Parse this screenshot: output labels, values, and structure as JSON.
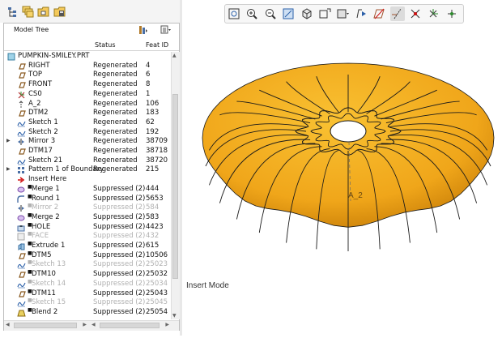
{
  "model_tree": {
    "title": "Model Tree",
    "columns": {
      "status": "Status",
      "feat_id": "Feat ID"
    },
    "root": "PUMPKIN-SMILEY.PRT",
    "rows": [
      {
        "name": "RIGHT",
        "status": "Regenerated",
        "id": "4",
        "icon": "datum-plane-icon",
        "state": "normal"
      },
      {
        "name": "TOP",
        "status": "Regenerated",
        "id": "6",
        "icon": "datum-plane-icon",
        "state": "normal"
      },
      {
        "name": "FRONT",
        "status": "Regenerated",
        "id": "8",
        "icon": "datum-plane-icon",
        "state": "normal"
      },
      {
        "name": "CS0",
        "status": "Regenerated",
        "id": "1",
        "icon": "csys-icon",
        "state": "normal"
      },
      {
        "name": "A_2",
        "status": "Regenerated",
        "id": "106",
        "icon": "axis-icon",
        "state": "normal"
      },
      {
        "name": "DTM2",
        "status": "Regenerated",
        "id": "183",
        "icon": "datum-plane-icon",
        "state": "normal"
      },
      {
        "name": "Sketch 1",
        "status": "Regenerated",
        "id": "62",
        "icon": "sketch-icon",
        "state": "normal"
      },
      {
        "name": "Sketch 2",
        "status": "Regenerated",
        "id": "192",
        "icon": "sketch-icon",
        "state": "normal"
      },
      {
        "name": "Mirror 3",
        "status": "Regenerated",
        "id": "38709",
        "icon": "mirror-icon",
        "state": "normal",
        "expand": true
      },
      {
        "name": "DTM17",
        "status": "Regenerated",
        "id": "38718",
        "icon": "datum-plane-icon",
        "state": "normal"
      },
      {
        "name": "Sketch 21",
        "status": "Regenerated",
        "id": "38720",
        "icon": "sketch-icon",
        "state": "normal"
      },
      {
        "name": "Pattern 1 of Boundary",
        "status": "Regenerated",
        "id": "215",
        "icon": "pattern-icon",
        "state": "normal",
        "expand": true
      },
      {
        "name": "Insert Here",
        "status": "",
        "id": "",
        "icon": "insert-arrow-icon",
        "state": "insert"
      },
      {
        "name": "Merge 1",
        "status": "Suppressed (2)",
        "id": "444",
        "icon": "merge-icon",
        "state": "suppressed"
      },
      {
        "name": "Round 1",
        "status": "Suppressed (2)",
        "id": "5653",
        "icon": "round-icon",
        "state": "suppressed"
      },
      {
        "name": "Mirror 2",
        "status": "Suppressed (2)",
        "id": "584",
        "icon": "mirror-icon",
        "state": "dim"
      },
      {
        "name": "Merge 2",
        "status": "Suppressed (2)",
        "id": "583",
        "icon": "merge-icon",
        "state": "suppressed"
      },
      {
        "name": "HOLE",
        "status": "Suppressed (2)",
        "id": "4423",
        "icon": "hole-icon",
        "state": "suppressed"
      },
      {
        "name": "FACE",
        "status": "Suppressed (2)",
        "id": "432",
        "icon": "face-icon",
        "state": "dim"
      },
      {
        "name": "Extrude 1",
        "status": "Suppressed (2)",
        "id": "615",
        "icon": "extrude-icon",
        "state": "suppressed"
      },
      {
        "name": "DTM5",
        "status": "Suppressed (2)",
        "id": "10506",
        "icon": "datum-plane-icon",
        "state": "suppressed"
      },
      {
        "name": "Sketch 13",
        "status": "Suppressed (2)",
        "id": "25023",
        "icon": "sketch-icon",
        "state": "dim"
      },
      {
        "name": "DTM10",
        "status": "Suppressed (2)",
        "id": "25032",
        "icon": "datum-plane-icon",
        "state": "suppressed"
      },
      {
        "name": "Sketch 14",
        "status": "Suppressed (2)",
        "id": "25034",
        "icon": "sketch-icon",
        "state": "dim"
      },
      {
        "name": "DTM11",
        "status": "Suppressed (2)",
        "id": "25043",
        "icon": "datum-plane-icon",
        "state": "suppressed"
      },
      {
        "name": "Sketch 15",
        "status": "Suppressed (2)",
        "id": "25045",
        "icon": "sketch-icon",
        "state": "dim"
      },
      {
        "name": "Blend 2",
        "status": "Suppressed (2)",
        "id": "25054",
        "icon": "blend-icon",
        "state": "suppressed"
      }
    ]
  },
  "viewport": {
    "axis_label": "A_2",
    "mode_text": "Insert Mode",
    "colors": {
      "pumpkin": "#f0a61a",
      "pumpkin_dark": "#c97f08",
      "edge": "#1a1a1a",
      "background": "#ffffff"
    }
  },
  "top_toolbar_icons": [
    "refit-icon",
    "zoom-in-icon",
    "zoom-out-icon",
    "repaint-icon",
    "view-orientation-icon",
    "saved-views-icon",
    "display-style-icon",
    "annotation-display-icon",
    "plane-display-icon",
    "axis-display-icon",
    "point-display-icon",
    "csys-display-icon",
    "spin-center-icon"
  ],
  "left_toolbar_icons": [
    "model-tree-icon",
    "layers-icon",
    "folder-browser-icon",
    "favorites-icon"
  ]
}
